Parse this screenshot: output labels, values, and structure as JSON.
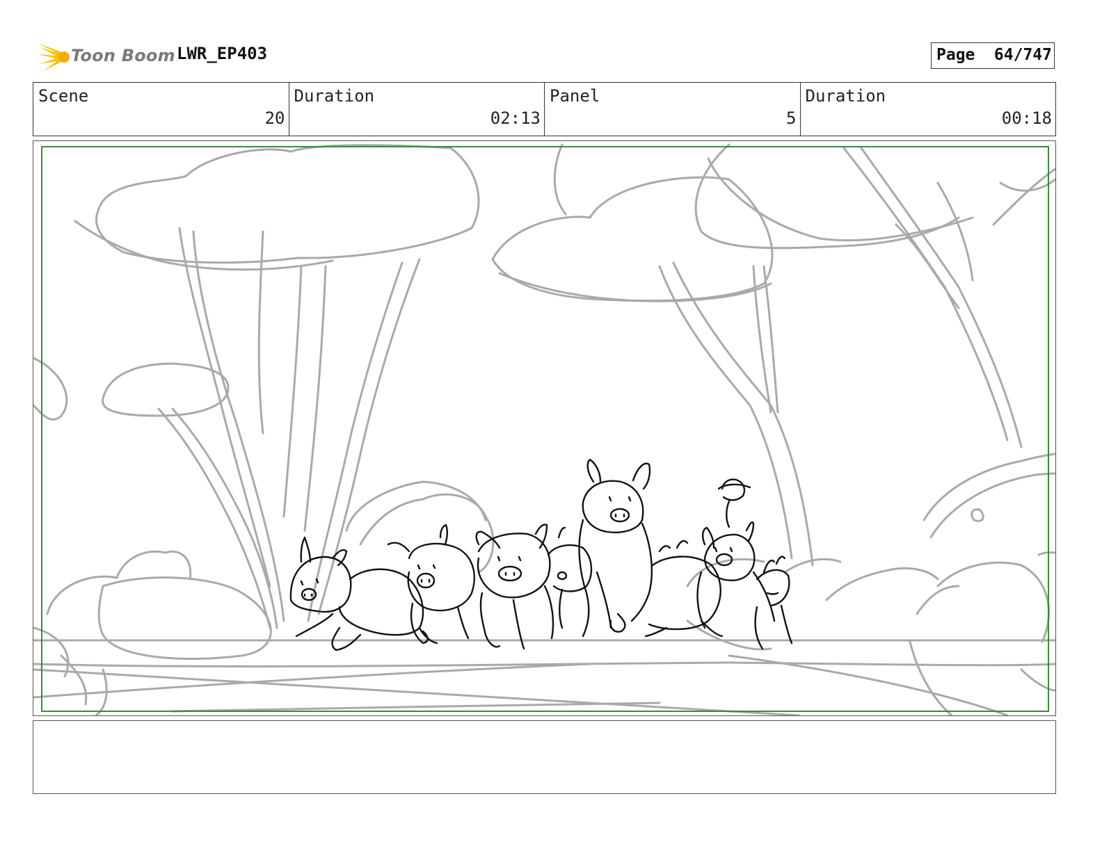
{
  "header": {
    "logo_text": "Toon Boom",
    "project": "LWR_EP403",
    "page_label": "Page",
    "page_value": "64/747"
  },
  "info": {
    "scene_label": "Scene",
    "scene_value": "20",
    "scene_duration_label": "Duration",
    "scene_duration_value": "02:13",
    "panel_label": "Panel",
    "panel_value": "5",
    "panel_duration_label": "Duration",
    "panel_duration_value": "00:18"
  },
  "colors": {
    "safe_frame": "#3a8a3a",
    "background_sketch": "#a9a9a9",
    "character_sketch": "#111111",
    "logo_star": "#f5c400"
  },
  "notes": ""
}
